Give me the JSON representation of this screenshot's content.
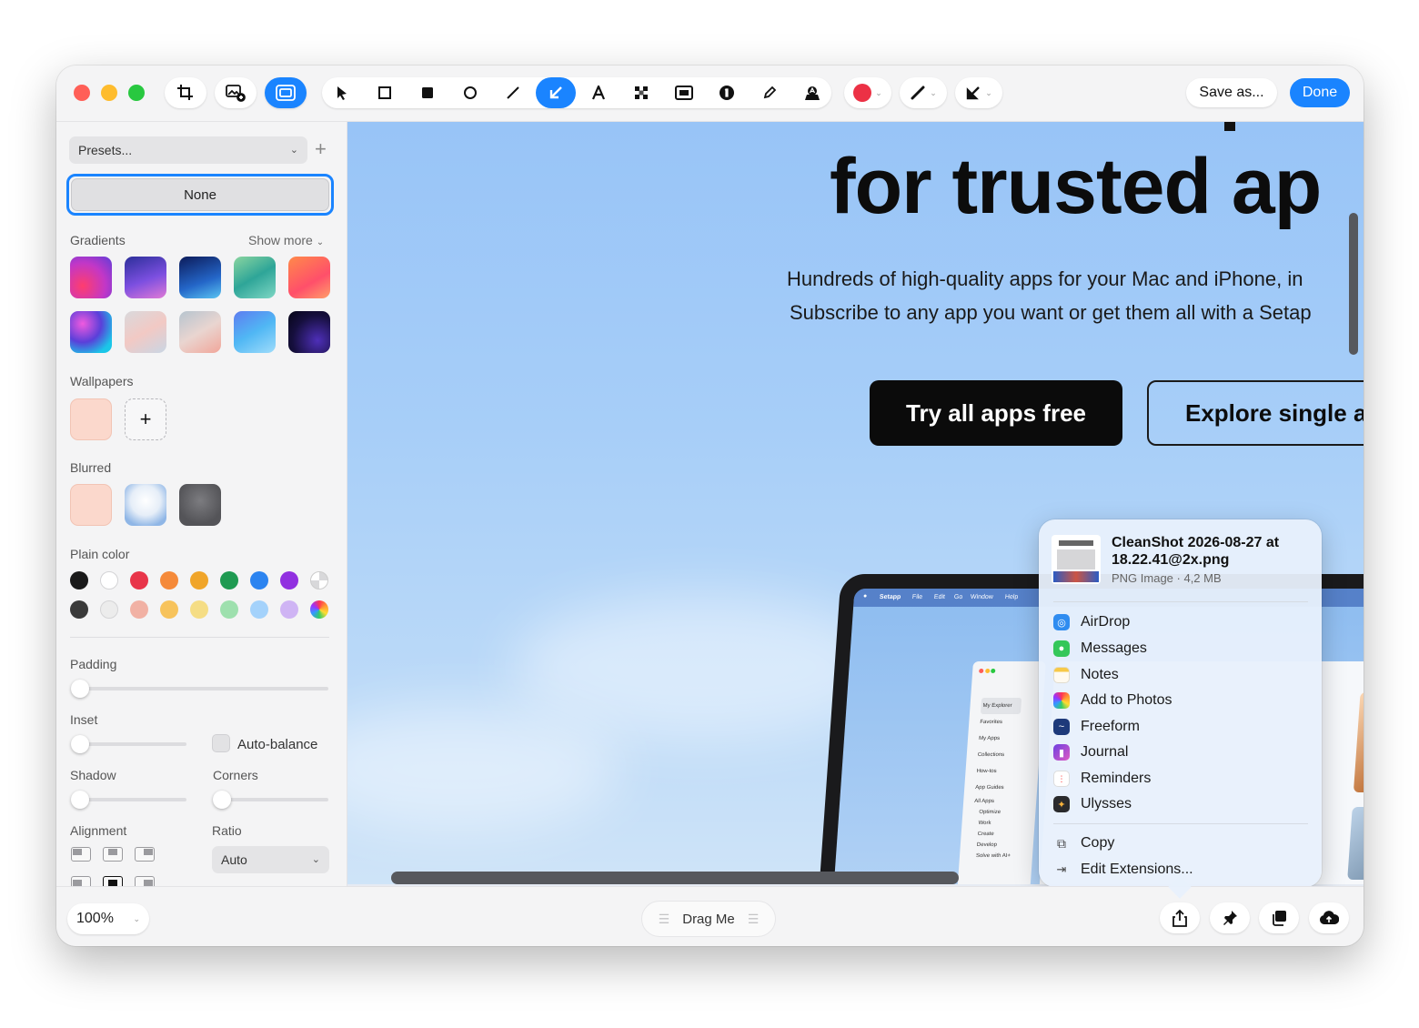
{
  "toolbar": {
    "save_as_label": "Save as...",
    "done_label": "Done",
    "colors": {
      "accent": "#1a84ff",
      "active_color": "#ec3145"
    }
  },
  "sidebar": {
    "presets_label": "Presets...",
    "none_label": "None",
    "gradients_label": "Gradients",
    "show_more_label": "Show more",
    "wallpapers_label": "Wallpapers",
    "blurred_label": "Blurred",
    "plain_color_label": "Plain color",
    "padding_label": "Padding",
    "inset_label": "Inset",
    "auto_balance_label": "Auto-balance",
    "shadow_label": "Shadow",
    "corners_label": "Corners",
    "alignment_label": "Alignment",
    "ratio_label": "Ratio",
    "ratio_value": "Auto",
    "plain_colors_row1": [
      "#1a1a1a",
      "#ffffff",
      "#e8354a",
      "#f58a3a",
      "#f0a52a",
      "#1f9a52",
      "#2c84f0",
      "#9130e0"
    ],
    "plain_colors_row2": [
      "#3a3a3a",
      "#ececec",
      "#f1b1a4",
      "#f7c35c",
      "#f5dd85",
      "#9ee0ae",
      "#a4d2fb",
      "#cfb4f4"
    ]
  },
  "canvas": {
    "hero_title": "for trusted ap",
    "hero_sub_line1": "Hundreds of high-quality apps for your Mac and iPhone, in",
    "hero_sub_line2": "Subscribe to any app you want or get them all with a Setap",
    "cta_primary": "Try all apps free",
    "cta_secondary": "Explore single ap",
    "mini_menu": [
      "Setapp",
      "File",
      "Edit",
      "Go",
      "Window",
      "Help"
    ],
    "mini_sidebar": [
      "My Explorer",
      "Favorites",
      "My Apps",
      "Collections",
      "How-tos",
      "App Guides",
      "All Apps",
      "Optimize",
      "Work",
      "Create",
      "Develop",
      "Solve with AI+"
    ]
  },
  "share": {
    "file_title": "CleanShot 2026-08-27 at 18.22.41@2x.png",
    "file_meta": "PNG Image · 4,2 MB",
    "apps": [
      "AirDrop",
      "Messages",
      "Notes",
      "Add to Photos",
      "Freeform",
      "Journal",
      "Reminders",
      "Ulysses"
    ],
    "copy_label": "Copy",
    "edit_extensions_label": "Edit Extensions..."
  },
  "bottom": {
    "zoom_value": "100%",
    "drag_label": "Drag Me"
  }
}
